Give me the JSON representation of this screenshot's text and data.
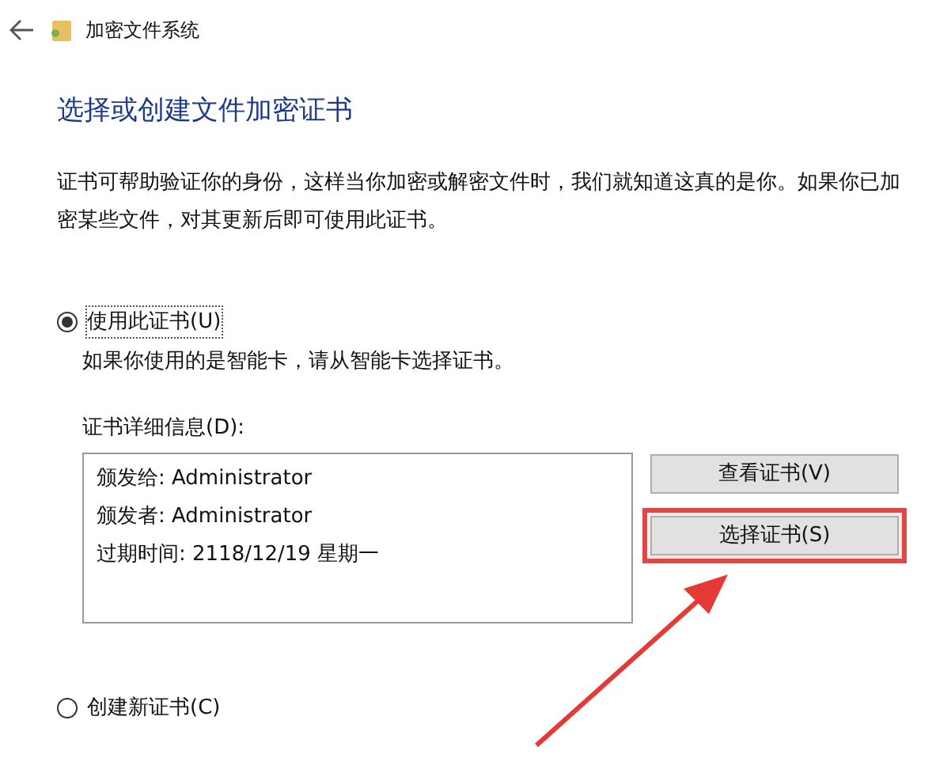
{
  "window": {
    "title": "加密文件系统"
  },
  "heading": "选择或创建文件加密证书",
  "description": "证书可帮助验证你的身份，这样当你加密或解密文件时，我们就知道这真的是你。如果你已加密某些文件，对其更新后即可使用此证书。",
  "options": [
    {
      "label": "使用此证书(U)",
      "selected": true,
      "hint": "如果你使用的是智能卡，请从智能卡选择证书。"
    },
    {
      "label": "创建新证书(C)",
      "selected": false
    }
  ],
  "details": {
    "label": "证书详细信息(D):",
    "lines": [
      "颁发给: Administrator",
      "颁发者: Administrator",
      "过期时间: 2118/12/19 星期一"
    ]
  },
  "buttons": [
    {
      "label": "查看证书(V)",
      "highlighted": false
    },
    {
      "label": "选择证书(S)",
      "highlighted": true
    }
  ]
}
